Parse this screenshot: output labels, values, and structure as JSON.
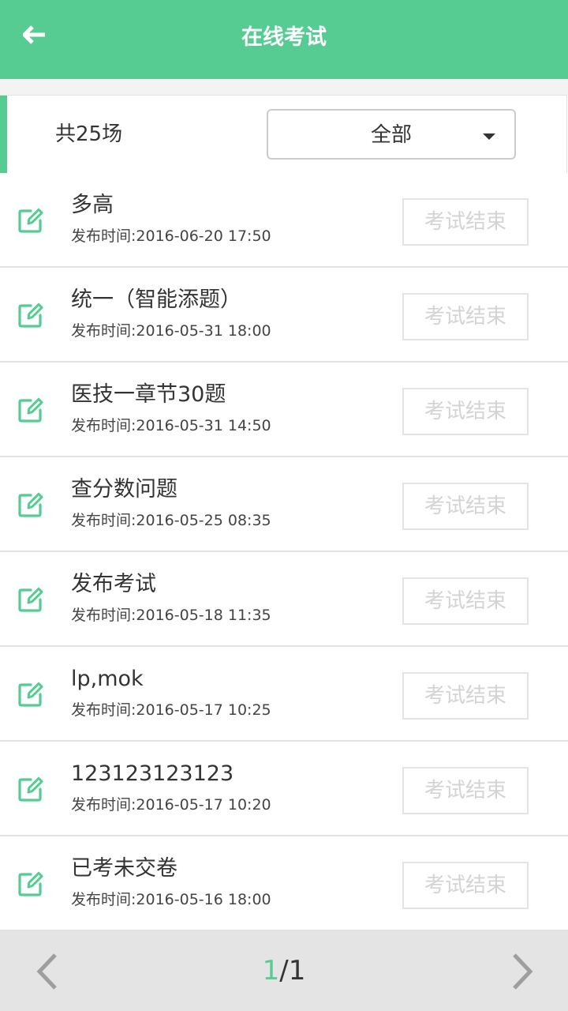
{
  "header": {
    "title": "在线考试",
    "back_icon": "arrow-left-icon"
  },
  "filter": {
    "total_label": "共25场",
    "category_selected": "全部"
  },
  "colors": {
    "accent": "#56cc92",
    "disabled_text": "#d3d3d3"
  },
  "exams": [
    {
      "title": "多高",
      "time": "发布时间:2016-06-20 17:50",
      "status": "考试结束"
    },
    {
      "title": "统一（智能添题）",
      "time": "发布时间:2016-05-31 18:00",
      "status": "考试结束"
    },
    {
      "title": "医技一章节30题",
      "time": "发布时间:2016-05-31 14:50",
      "status": "考试结束"
    },
    {
      "title": "查分数问题",
      "time": "发布时间:2016-05-25 08:35",
      "status": "考试结束"
    },
    {
      "title": "发布考试",
      "time": "发布时间:2016-05-18 11:35",
      "status": "考试结束"
    },
    {
      "title": "lp,mok",
      "time": "发布时间:2016-05-17 10:25",
      "status": "考试结束"
    },
    {
      "title": "123123123123",
      "time": "发布时间:2016-05-17 10:20",
      "status": "考试结束"
    },
    {
      "title": "已考未交卷",
      "time": "发布时间:2016-05-16 18:00",
      "status": "考试结束"
    }
  ],
  "pager": {
    "current": "1",
    "separator": "/",
    "total": "1"
  }
}
